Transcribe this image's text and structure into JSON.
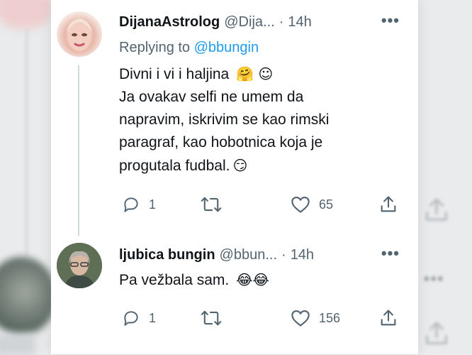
{
  "thread": {
    "tweets": [
      {
        "display_name": "DijanaAstrolog",
        "handle": "@Dija...",
        "separator": "·",
        "time": "14h",
        "replying_prefix": "Replying to",
        "replying_to": "@bbungin",
        "lines": [
          "Divni i vi i haljina",
          "Ja ovakav selfi ne umem da",
          "napravim, iskrivim se kao rimski",
          "paragraf, kao hobotnica koja je",
          "progutala fudbal."
        ],
        "emojis": {
          "line1": "🤗 ☺",
          "line5": "😏"
        },
        "replies": "1",
        "retweets": "",
        "likes": "65"
      },
      {
        "display_name": "ljubica bungin",
        "handle": "@bbun...",
        "separator": "·",
        "time": "14h",
        "lines": [
          "Pa vežbala sam."
        ],
        "emojis": {
          "line1": "😂😂"
        },
        "replies": "1",
        "retweets": "",
        "likes": "156"
      }
    ]
  },
  "icons": [
    "more-icon",
    "reply-icon",
    "retweet-icon",
    "like-icon",
    "share-icon"
  ],
  "colors": {
    "link": "#1d9bf0",
    "muted": "#536471",
    "text": "#0f1419",
    "thread_line": "#cfd9de"
  }
}
